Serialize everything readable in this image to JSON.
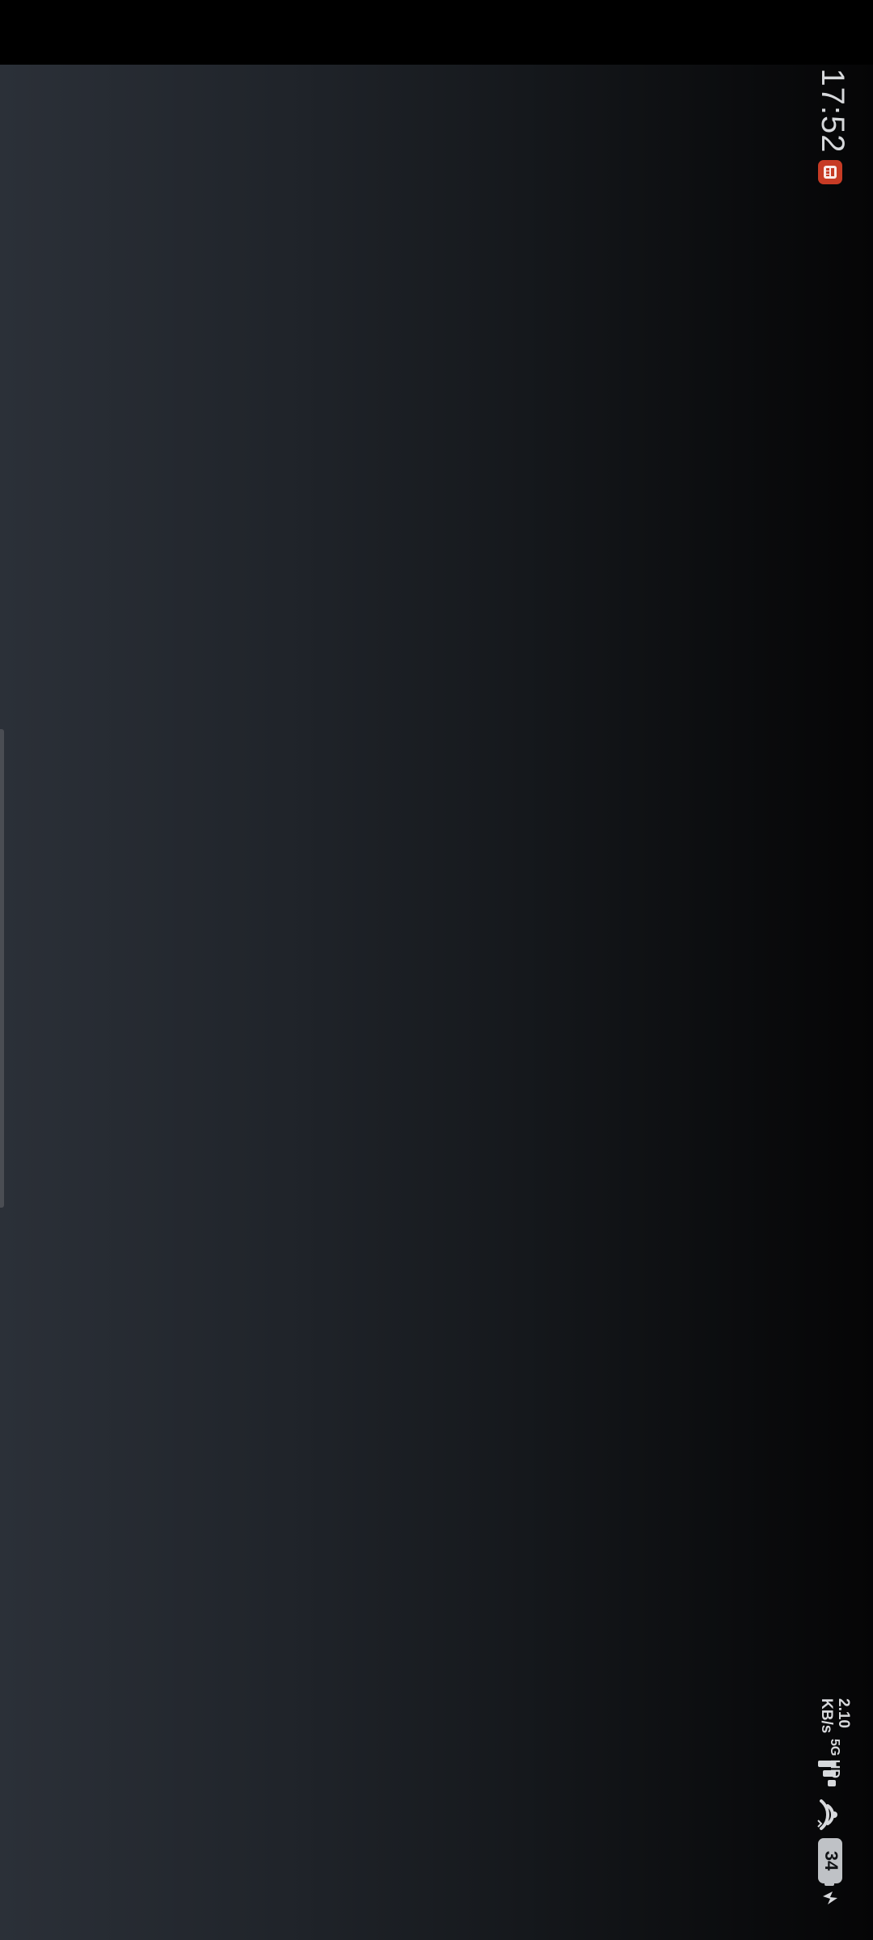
{
  "status_bar": {
    "time": "17:52",
    "net_speed_value": "2.10",
    "net_speed_unit": "KB/s",
    "network_type": "5G HD",
    "battery_level": "34",
    "icons": {
      "notification_app": "app-notification-icon",
      "signal": "cellular-signal-icon",
      "wifi": "wifi-icon",
      "battery": "battery-icon",
      "charging": "charging-bolt-icon"
    }
  },
  "colors": {
    "background": "#000000",
    "wallpaper_left": "#2b3038",
    "wallpaper_right": "#050506",
    "status_text": "#d7d9dc",
    "app_badge": "#c73b25",
    "edge_handle": "#4a4d53"
  }
}
